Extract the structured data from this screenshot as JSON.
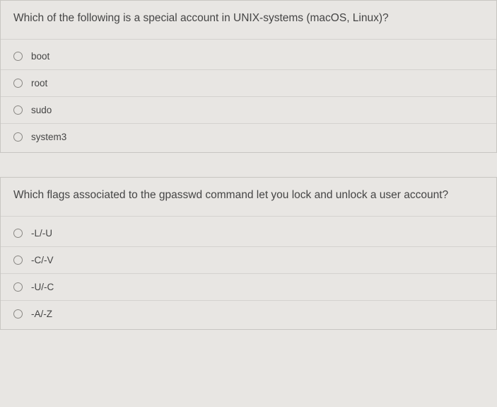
{
  "questions": [
    {
      "prompt": "Which of the following is a special account in UNIX-systems (macOS, Linux)?",
      "options": [
        "boot",
        "root",
        "sudo",
        "system3"
      ]
    },
    {
      "prompt": "Which flags associated to the gpasswd command let you lock and unlock a user account?",
      "options": [
        "-L/-U",
        "-C/-V",
        "-U/-C",
        "-A/-Z"
      ]
    }
  ]
}
